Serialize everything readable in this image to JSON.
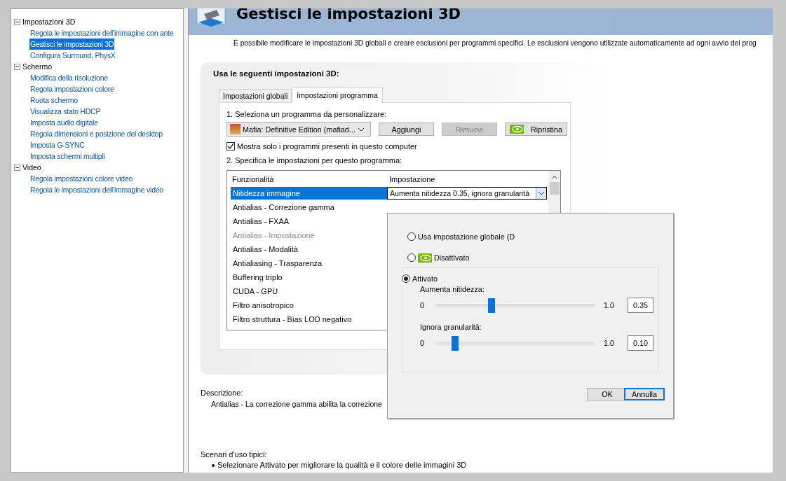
{
  "sidebar": {
    "tree": [
      {
        "label": "Impostazioni 3D",
        "expanded": true,
        "children": [
          {
            "label": "Regola le impostazioni dell'immagine con ante",
            "selected": false
          },
          {
            "label": "Gestisci le impostazioni 3D",
            "selected": true
          },
          {
            "label": "Configura Surround, PhysX",
            "selected": false
          }
        ]
      },
      {
        "label": "Schermo",
        "expanded": true,
        "children": [
          {
            "label": "Modifica della risoluzione",
            "selected": false
          },
          {
            "label": "Regola impostazioni colore",
            "selected": false
          },
          {
            "label": "Ruota schermo",
            "selected": false
          },
          {
            "label": "Visualizza stato HDCP",
            "selected": false
          },
          {
            "label": "Imposta audio digitale",
            "selected": false
          },
          {
            "label": "Regola dimensioni e posizione del desktop",
            "selected": false
          },
          {
            "label": "Imposta G-SYNC",
            "selected": false
          },
          {
            "label": "Imposta schermi multipli",
            "selected": false
          }
        ]
      },
      {
        "label": "Video",
        "expanded": true,
        "children": [
          {
            "label": "Regola impostazioni colore video",
            "selected": false
          },
          {
            "label": "Regola le impostazioni dell'immagine video",
            "selected": false
          }
        ]
      }
    ]
  },
  "header": {
    "title": "Gestisci le impostazioni 3D",
    "description": "È possibile modificare le impostazioni 3D globali e creare esclusioni per programmi specifici. Le esclusioni vengono utilizzate automaticamente ad ogni avvio dei prog"
  },
  "settings": {
    "heading": "Usa le seguenti impostazioni 3D:",
    "tabs": [
      {
        "label": "Impostazioni globali",
        "selected": false
      },
      {
        "label": "Impostazioni programma",
        "selected": true
      }
    ],
    "step1": "1. Seleziona un programma da personalizzare:",
    "program": "Mafia: Definitive Edition (mafiad...",
    "buttons": [
      {
        "label": "Aggiungi",
        "disabled": false,
        "kind": "plain"
      },
      {
        "label": "Rimuovi",
        "disabled": true,
        "kind": "plain"
      },
      {
        "label": "Ripristina",
        "disabled": false,
        "kind": "logo"
      }
    ],
    "filter": {
      "label": "Mostra solo i programmi presenti in questo computer",
      "checked": true
    },
    "step2": "2. Specifica le impostazioni per questo programma:",
    "table": {
      "columns": [
        "Funzionalità",
        "Impostazione"
      ],
      "rows": [
        {
          "feature": "Nitidezza immagine",
          "setting": "Aumenta nitidezza 0.35, ignora granularità",
          "selected": true,
          "disabled": false
        },
        {
          "feature": "Antialias - Correzione gamma",
          "selected": false,
          "disabled": false
        },
        {
          "feature": "Antialias - FXAA",
          "selected": false,
          "disabled": false
        },
        {
          "feature": "Antialias - Impostazione",
          "selected": false,
          "disabled": true
        },
        {
          "feature": "Antialias - Modalità",
          "selected": false,
          "disabled": false
        },
        {
          "feature": "Antialiasing - Trasparenza",
          "selected": false,
          "disabled": false
        },
        {
          "feature": "Buffering triplo",
          "selected": false,
          "disabled": false
        },
        {
          "feature": "CUDA - GPU",
          "selected": false,
          "disabled": false
        },
        {
          "feature": "Filtro anisotropico",
          "selected": false,
          "disabled": false
        },
        {
          "feature": "Filtro struttura - Bias LOD negativo",
          "selected": false,
          "disabled": false
        }
      ]
    }
  },
  "popup": {
    "options": [
      {
        "label": "Usa impostazione globale (D",
        "selected": false,
        "kind": "plain"
      },
      {
        "label": "Disattivato",
        "selected": false,
        "kind": "logo"
      },
      {
        "label": "Attivato",
        "selected": true,
        "kind": "group"
      }
    ],
    "sliders": [
      {
        "label": "Aumenta nitidezza:",
        "min": "0",
        "max": "1.0",
        "value": "0.35",
        "level": 0.35
      },
      {
        "label": "Ignora granularità:",
        "min": "0",
        "max": "1.0",
        "value": "0.10",
        "level": 0.12
      }
    ],
    "buttons": [
      {
        "label": "OK",
        "default": false
      },
      {
        "label": "Annulla",
        "default": true
      }
    ]
  },
  "description": {
    "label": "Descrizione:",
    "text": "Antialias - La correzione gamma abilita la correzione"
  },
  "scenarios": {
    "label": "Scenari d'uso tipici:",
    "items": [
      "Selezionare Attivato per migliorare la qualità e il colore delle immagini 3D"
    ]
  }
}
